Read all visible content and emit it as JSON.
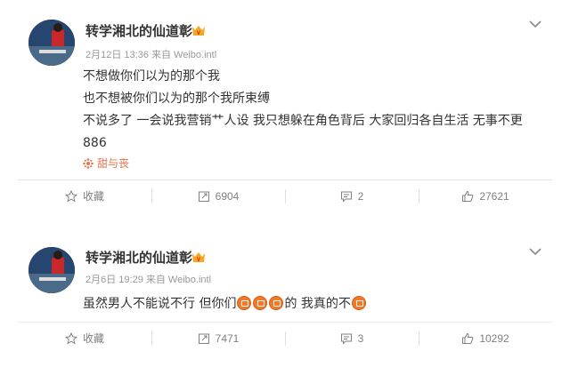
{
  "posts": [
    {
      "username": "转学湘北的仙道彰",
      "meta": "2月12日 13:36 来自 Weibo.intl",
      "lines": [
        "不想做你们以为的那个我",
        "也不想被你们以为的那个我所束缚",
        "不说多了 一会说我营销艹人设 我只想躲在角色背后 大家回归各自生活 无事不更",
        "886"
      ],
      "topic": "甜与丧",
      "actions": {
        "favorite": "收藏",
        "repost": "6904",
        "comment": "2",
        "like": "27621"
      }
    },
    {
      "username": "转学湘北的仙道彰",
      "meta": "2月6日 19:29 来自 Weibo.intl",
      "line_parts": [
        "虽然男人不能说不行 但你们",
        "的 我真的不"
      ],
      "actions": {
        "favorite": "收藏",
        "repost": "7471",
        "comment": "3",
        "like": "10292"
      }
    }
  ],
  "colors": {
    "topic": "#eb7350",
    "meta": "#999999",
    "emoji": "#f07a2a"
  },
  "icons": [
    "chevron-down-icon",
    "vip-badge-icon",
    "star-icon",
    "repost-icon",
    "comment-icon",
    "thumbs-up-icon",
    "topic-icon",
    "emoji-icon"
  ]
}
